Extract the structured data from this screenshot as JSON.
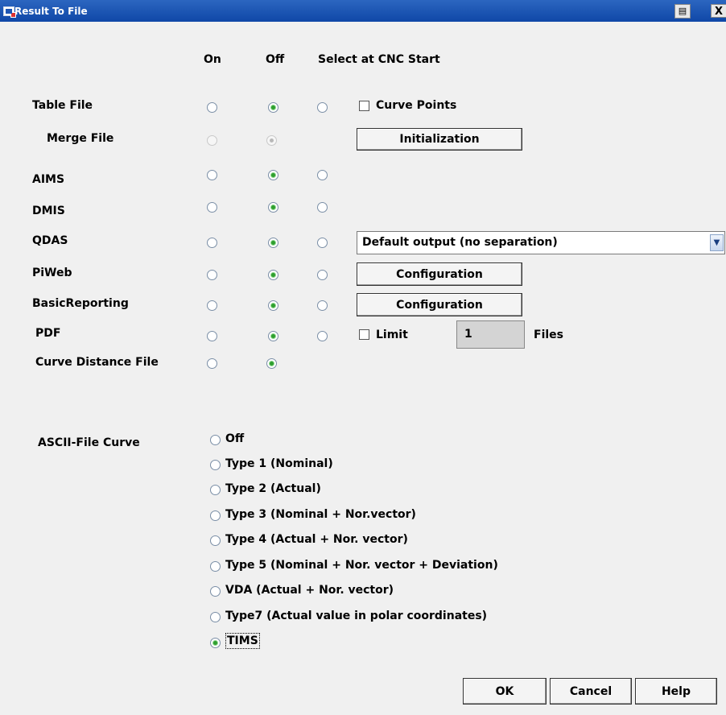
{
  "window": {
    "title": "Result To File",
    "icons": {
      "app": "window-app-icon",
      "print": "print-icon",
      "close": "close-icon"
    },
    "close_glyph": "X"
  },
  "columns": {
    "on": "On",
    "off": "Off",
    "select": "Select at CNC Start"
  },
  "rows": [
    {
      "label": "Table File",
      "on": false,
      "off": true,
      "select": false
    },
    {
      "label": "Merge File",
      "on": false,
      "off": true,
      "disabled": true
    },
    {
      "label": "AIMS",
      "on": false,
      "off": true,
      "select": false
    },
    {
      "label": "DMIS",
      "on": false,
      "off": true,
      "select": false
    },
    {
      "label": "QDAS",
      "on": false,
      "off": true,
      "select": false
    },
    {
      "label": "PiWeb",
      "on": false,
      "off": true,
      "select": false
    },
    {
      "label": "BasicReporting",
      "on": false,
      "off": true,
      "select": false
    },
    {
      "label": "PDF",
      "on": false,
      "off": true,
      "select": false
    },
    {
      "label": "Curve Distance File",
      "on": false,
      "off": true
    }
  ],
  "curve_points": {
    "label": "Curve Points",
    "checked": false
  },
  "initialization_button": "Initialization",
  "qdas_output": {
    "selected": "Default output (no separation)"
  },
  "piweb_config_button": "Configuration",
  "basic_config_button": "Configuration",
  "pdf_limit": {
    "label": "Limit",
    "checked": false,
    "value": "1",
    "unit": "Files"
  },
  "ascii_curve": {
    "label": "ASCII-File Curve",
    "options": [
      "Off",
      "Type 1 (Nominal)",
      "Type 2 (Actual)",
      "Type 3 (Nominal + Nor.vector)",
      "Type 4 (Actual + Nor. vector)",
      "Type 5 (Nominal + Nor. vector + Deviation)",
      "VDA (Actual + Nor. vector)",
      "Type7 (Actual value in polar coordinates)",
      "TIMS"
    ],
    "selected": "TIMS"
  },
  "buttons": {
    "ok": "OK",
    "cancel": "Cancel",
    "help": "Help"
  },
  "colors": {
    "titlebar": "#0f47a7",
    "radio_checked": "#2f9f2f",
    "background": "#f0f0f0"
  }
}
